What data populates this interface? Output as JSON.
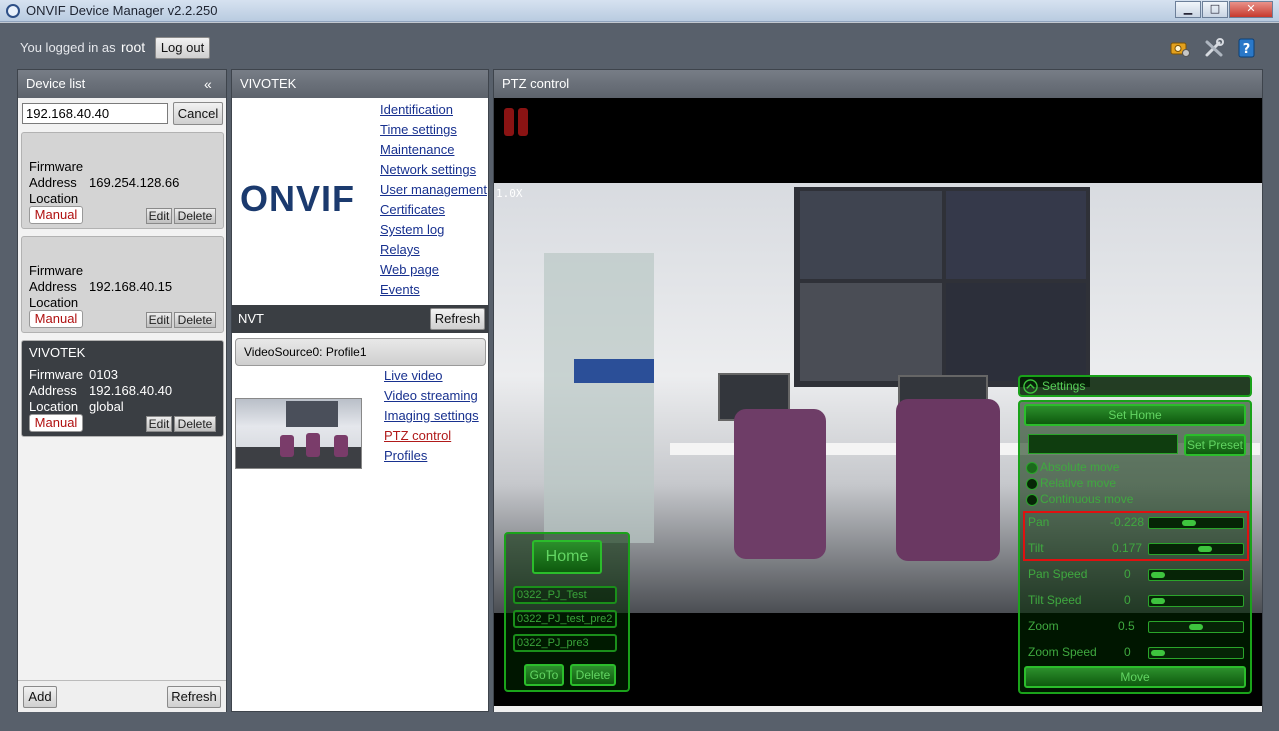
{
  "window": {
    "title": "ONVIF Device Manager v2.2.250",
    "minimize_glyph": "▁",
    "maximize_glyph": "□",
    "close_glyph": "✕"
  },
  "login": {
    "label": "You logged in as",
    "user": "root",
    "logout_label": "Log out"
  },
  "toolbar_icons": [
    "camera-settings-icon",
    "tools-icon",
    "help-icon"
  ],
  "device_list": {
    "title": "Device list",
    "collapse_glyph": "«",
    "search_value": "192.168.40.40",
    "cancel_label": "Cancel",
    "field_labels": {
      "firmware": "Firmware",
      "address": "Address",
      "location": "Location"
    },
    "devices": [
      {
        "name": "",
        "firmware": "",
        "address": "169.254.128.66",
        "location": "",
        "mode": "Manual",
        "edit": "Edit",
        "delete": "Delete"
      },
      {
        "name": "",
        "firmware": "",
        "address": "192.168.40.15",
        "location": "",
        "mode": "Manual",
        "edit": "Edit",
        "delete": "Delete"
      },
      {
        "name": "VIVOTEK",
        "firmware": "0103",
        "address": "192.168.40.40",
        "location": "global",
        "mode": "Manual",
        "edit": "Edit",
        "delete": "Delete"
      }
    ],
    "add_label": "Add",
    "refresh_label": "Refresh"
  },
  "device_panel": {
    "title": "VIVOTEK",
    "logo_text": "ONVIF",
    "links": [
      "Identification",
      "Time settings",
      "Maintenance",
      "Network settings",
      "User management",
      "Certificates",
      "System log",
      "Relays",
      "Web page",
      "Events"
    ],
    "nvt": {
      "title": "NVT",
      "refresh_label": "Refresh",
      "profile": "VideoSource0: Profile1",
      "links": [
        "Live video",
        "Video streaming",
        "Imaging settings",
        "PTZ control",
        "Profiles"
      ]
    }
  },
  "ptz": {
    "title": "PTZ control",
    "zoom_overlay": "1.0X",
    "presets_panel": {
      "home_label": "Home",
      "presets": [
        "0322_PJ_Test",
        "0322_PJ_test_pre2",
        "0322_PJ_pre3"
      ],
      "goto_label": "GoTo",
      "delete_label": "Delete"
    },
    "settings": {
      "header": "Settings",
      "set_home_label": "Set Home",
      "preset_name_value": "",
      "set_preset_label": "Set Preset",
      "modes": [
        "Absolute move",
        "Relative move",
        "Continuous move"
      ],
      "pan_label": "Pan",
      "pan_value": "-0.228",
      "tilt_label": "Tilt",
      "tilt_value": "0.177",
      "pan_speed_label": "Pan Speed",
      "pan_speed_value": "0",
      "tilt_speed_label": "Tilt Speed",
      "tilt_speed_value": "0",
      "zoom_label": "Zoom",
      "zoom_value": "0.5",
      "zoom_speed_label": "Zoom Speed",
      "zoom_speed_value": "0",
      "move_label": "Move"
    }
  },
  "colors": {
    "highlight_box": "#e01010",
    "ptz_accent": "#1aa21a",
    "active_link": "#b01a1a"
  }
}
